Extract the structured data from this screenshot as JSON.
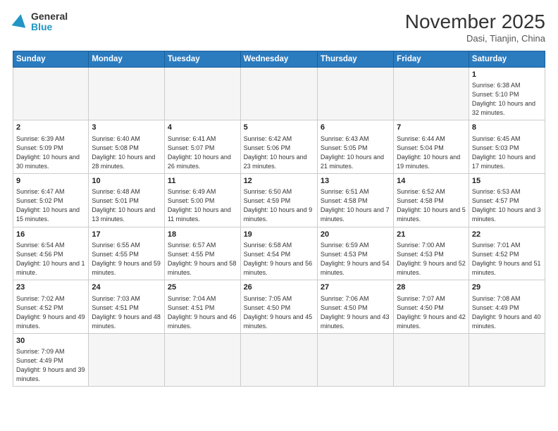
{
  "header": {
    "logo_general": "General",
    "logo_blue": "Blue",
    "month_title": "November 2025",
    "location": "Dasi, Tianjin, China"
  },
  "days_of_week": [
    "Sunday",
    "Monday",
    "Tuesday",
    "Wednesday",
    "Thursday",
    "Friday",
    "Saturday"
  ],
  "weeks": [
    [
      {
        "num": "",
        "info": ""
      },
      {
        "num": "",
        "info": ""
      },
      {
        "num": "",
        "info": ""
      },
      {
        "num": "",
        "info": ""
      },
      {
        "num": "",
        "info": ""
      },
      {
        "num": "",
        "info": ""
      },
      {
        "num": "1",
        "info": "Sunrise: 6:38 AM\nSunset: 5:10 PM\nDaylight: 10 hours and 32 minutes."
      }
    ],
    [
      {
        "num": "2",
        "info": "Sunrise: 6:39 AM\nSunset: 5:09 PM\nDaylight: 10 hours and 30 minutes."
      },
      {
        "num": "3",
        "info": "Sunrise: 6:40 AM\nSunset: 5:08 PM\nDaylight: 10 hours and 28 minutes."
      },
      {
        "num": "4",
        "info": "Sunrise: 6:41 AM\nSunset: 5:07 PM\nDaylight: 10 hours and 26 minutes."
      },
      {
        "num": "5",
        "info": "Sunrise: 6:42 AM\nSunset: 5:06 PM\nDaylight: 10 hours and 23 minutes."
      },
      {
        "num": "6",
        "info": "Sunrise: 6:43 AM\nSunset: 5:05 PM\nDaylight: 10 hours and 21 minutes."
      },
      {
        "num": "7",
        "info": "Sunrise: 6:44 AM\nSunset: 5:04 PM\nDaylight: 10 hours and 19 minutes."
      },
      {
        "num": "8",
        "info": "Sunrise: 6:45 AM\nSunset: 5:03 PM\nDaylight: 10 hours and 17 minutes."
      }
    ],
    [
      {
        "num": "9",
        "info": "Sunrise: 6:47 AM\nSunset: 5:02 PM\nDaylight: 10 hours and 15 minutes."
      },
      {
        "num": "10",
        "info": "Sunrise: 6:48 AM\nSunset: 5:01 PM\nDaylight: 10 hours and 13 minutes."
      },
      {
        "num": "11",
        "info": "Sunrise: 6:49 AM\nSunset: 5:00 PM\nDaylight: 10 hours and 11 minutes."
      },
      {
        "num": "12",
        "info": "Sunrise: 6:50 AM\nSunset: 4:59 PM\nDaylight: 10 hours and 9 minutes."
      },
      {
        "num": "13",
        "info": "Sunrise: 6:51 AM\nSunset: 4:58 PM\nDaylight: 10 hours and 7 minutes."
      },
      {
        "num": "14",
        "info": "Sunrise: 6:52 AM\nSunset: 4:58 PM\nDaylight: 10 hours and 5 minutes."
      },
      {
        "num": "15",
        "info": "Sunrise: 6:53 AM\nSunset: 4:57 PM\nDaylight: 10 hours and 3 minutes."
      }
    ],
    [
      {
        "num": "16",
        "info": "Sunrise: 6:54 AM\nSunset: 4:56 PM\nDaylight: 10 hours and 1 minute."
      },
      {
        "num": "17",
        "info": "Sunrise: 6:55 AM\nSunset: 4:55 PM\nDaylight: 9 hours and 59 minutes."
      },
      {
        "num": "18",
        "info": "Sunrise: 6:57 AM\nSunset: 4:55 PM\nDaylight: 9 hours and 58 minutes."
      },
      {
        "num": "19",
        "info": "Sunrise: 6:58 AM\nSunset: 4:54 PM\nDaylight: 9 hours and 56 minutes."
      },
      {
        "num": "20",
        "info": "Sunrise: 6:59 AM\nSunset: 4:53 PM\nDaylight: 9 hours and 54 minutes."
      },
      {
        "num": "21",
        "info": "Sunrise: 7:00 AM\nSunset: 4:53 PM\nDaylight: 9 hours and 52 minutes."
      },
      {
        "num": "22",
        "info": "Sunrise: 7:01 AM\nSunset: 4:52 PM\nDaylight: 9 hours and 51 minutes."
      }
    ],
    [
      {
        "num": "23",
        "info": "Sunrise: 7:02 AM\nSunset: 4:52 PM\nDaylight: 9 hours and 49 minutes."
      },
      {
        "num": "24",
        "info": "Sunrise: 7:03 AM\nSunset: 4:51 PM\nDaylight: 9 hours and 48 minutes."
      },
      {
        "num": "25",
        "info": "Sunrise: 7:04 AM\nSunset: 4:51 PM\nDaylight: 9 hours and 46 minutes."
      },
      {
        "num": "26",
        "info": "Sunrise: 7:05 AM\nSunset: 4:50 PM\nDaylight: 9 hours and 45 minutes."
      },
      {
        "num": "27",
        "info": "Sunrise: 7:06 AM\nSunset: 4:50 PM\nDaylight: 9 hours and 43 minutes."
      },
      {
        "num": "28",
        "info": "Sunrise: 7:07 AM\nSunset: 4:50 PM\nDaylight: 9 hours and 42 minutes."
      },
      {
        "num": "29",
        "info": "Sunrise: 7:08 AM\nSunset: 4:49 PM\nDaylight: 9 hours and 40 minutes."
      }
    ],
    [
      {
        "num": "30",
        "info": "Sunrise: 7:09 AM\nSunset: 4:49 PM\nDaylight: 9 hours and 39 minutes."
      },
      {
        "num": "",
        "info": ""
      },
      {
        "num": "",
        "info": ""
      },
      {
        "num": "",
        "info": ""
      },
      {
        "num": "",
        "info": ""
      },
      {
        "num": "",
        "info": ""
      },
      {
        "num": "",
        "info": ""
      }
    ]
  ]
}
